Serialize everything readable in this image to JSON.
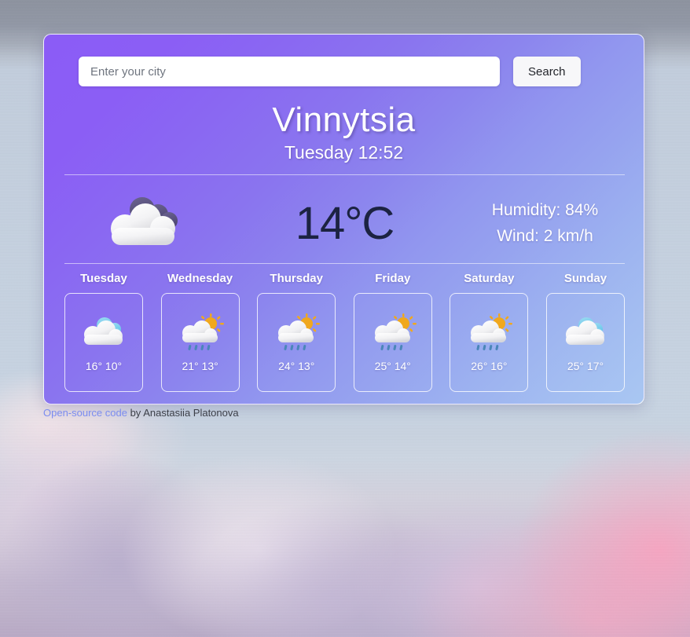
{
  "search": {
    "placeholder": "Enter your city",
    "value": "",
    "button_label": "Search"
  },
  "current": {
    "city": "Vinnytsia",
    "datetime": "Tuesday 12:52",
    "temperature": "14°C",
    "humidity": "Humidity: 84%",
    "wind": "Wind: 2 km/h",
    "icon": "cloudy-double-cloud-icon"
  },
  "forecast": [
    {
      "day": "Tuesday",
      "icon": "cloudy-icon",
      "temps": "16° 10°",
      "high": 16,
      "low": 10
    },
    {
      "day": "Wednesday",
      "icon": "sun-cloud-rain-icon",
      "temps": "21° 13°",
      "high": 21,
      "low": 13
    },
    {
      "day": "Thursday",
      "icon": "sun-cloud-rain-icon",
      "temps": "24° 13°",
      "high": 24,
      "low": 13
    },
    {
      "day": "Friday",
      "icon": "sun-cloud-rain-icon",
      "temps": "25° 14°",
      "high": 25,
      "low": 14
    },
    {
      "day": "Saturday",
      "icon": "sun-cloud-rain-icon",
      "temps": "26° 16°",
      "high": 26,
      "low": 16
    },
    {
      "day": "Sunday",
      "icon": "cloudy-icon",
      "temps": "25° 17°",
      "high": 25,
      "low": 17
    }
  ],
  "credit": {
    "link_text": "Open-source code",
    "author_text": " by Anastasiia Platonova"
  },
  "colors": {
    "card_gradient_start": "#8b5cf6",
    "card_gradient_end": "#a9c7f2",
    "temperature_text": "#1c2342",
    "link": "#7b8cf0",
    "sun": "#f0a81e",
    "rain": "#4a86b8"
  }
}
